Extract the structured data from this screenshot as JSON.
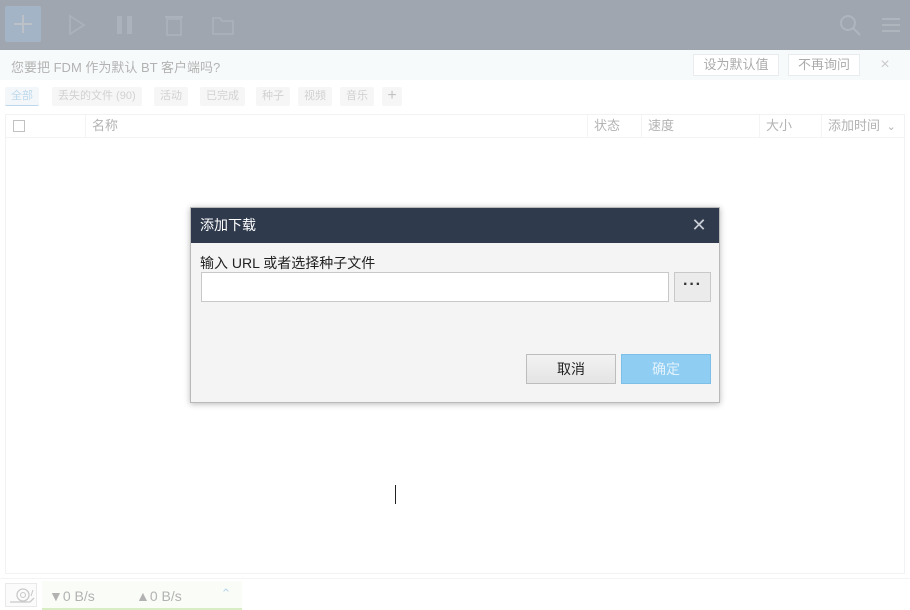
{
  "toolbar": {
    "icons": [
      "add-icon",
      "play-icon",
      "pause-icon",
      "delete-icon",
      "folder-icon",
      "search-icon",
      "menu-icon"
    ]
  },
  "notice": {
    "text": "您要把 FDM 作为默认 BT 客户端吗?",
    "set_default": "设为默认值",
    "dont_ask": "不再询问",
    "close": "×"
  },
  "tabs": [
    {
      "label": "全部",
      "active": true
    },
    {
      "label": "丢失的文件 (90)"
    },
    {
      "label": "活动"
    },
    {
      "label": "已完成"
    },
    {
      "label": "种子"
    },
    {
      "label": "视频"
    },
    {
      "label": "音乐"
    }
  ],
  "table": {
    "columns": [
      "名称",
      "状态",
      "速度",
      "大小",
      "添加时间"
    ],
    "sort_indicator": "⌄"
  },
  "dialog": {
    "title": "添加下载",
    "close": "✕",
    "label": "输入 URL 或者选择种子文件",
    "input_value": "",
    "browse": "···",
    "cancel": "取消",
    "ok": "确定"
  },
  "status": {
    "download": "▼0 B/s",
    "upload": "▲0 B/s",
    "expand": "⌃"
  },
  "colors": {
    "toolbar_bg": "#2f3a4c",
    "accent": "#3da1e6",
    "ok_disabled": "#8fcdf2"
  }
}
